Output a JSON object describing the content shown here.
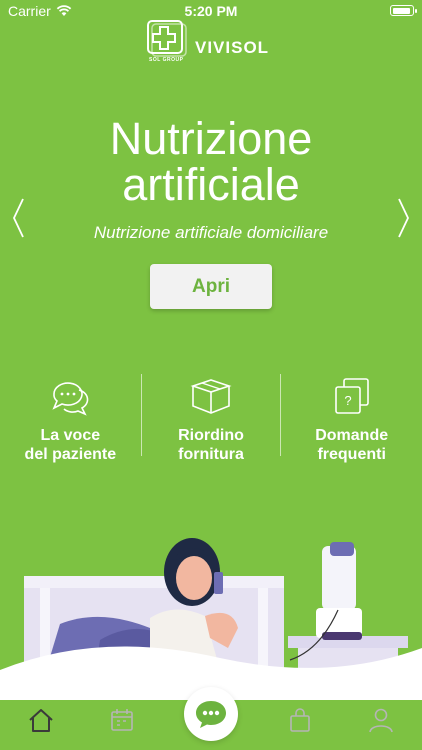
{
  "status_bar": {
    "carrier": "Carrier",
    "time": "5:20 PM"
  },
  "brand": {
    "name": "VIVISOL",
    "group": "SOL GROUP"
  },
  "hero": {
    "title_line1": "Nutrizione",
    "title_line2": "artificiale",
    "subtitle": "Nutrizione artificiale domiciliare",
    "button": "Apri"
  },
  "features": [
    {
      "line1": "La voce",
      "line2": "del paziente",
      "icon": "speech-bubble-icon"
    },
    {
      "line1": "Riordino",
      "line2": "fornitura",
      "icon": "box-icon"
    },
    {
      "line1": "Domande",
      "line2": "frequenti",
      "icon": "question-cards-icon"
    }
  ],
  "tabbar": {
    "icons": [
      "home-icon",
      "calendar-icon",
      "chat-icon",
      "bag-icon",
      "user-icon"
    ]
  },
  "colors": {
    "brand_green": "#7dc242",
    "button_text": "#6db33f",
    "tab_active": "#3a3a3a",
    "tab_inactive": "#b5b5b5"
  }
}
